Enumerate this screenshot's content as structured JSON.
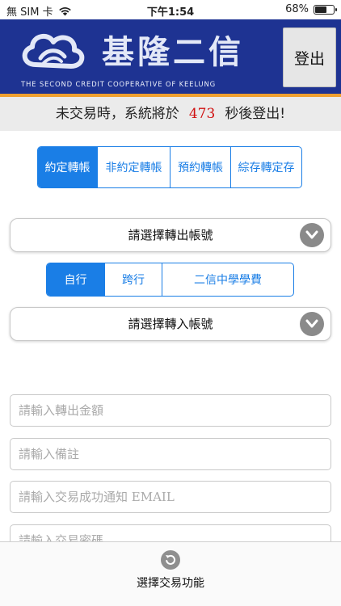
{
  "status_bar": {
    "carrier": "無 SIM 卡",
    "time": "下午1:54",
    "battery": "68%",
    "battery_level": 0.68
  },
  "header": {
    "bank_name": "基隆二信",
    "bank_subtitle": "THE SECOND CREDIT COOPERATIVE OF KEELUNG",
    "logout_label": "登出"
  },
  "timer": {
    "prefix": "未交易時，系統將於",
    "seconds": "473",
    "suffix": "秒後登出!"
  },
  "transfer_tabs": [
    "約定轉帳",
    "非約定轉帳",
    "預約轉帳",
    "綜存轉定存"
  ],
  "from_account": {
    "placeholder": "請選擇轉出帳號"
  },
  "bank_tabs": [
    "自行",
    "跨行",
    "二信中學學費"
  ],
  "to_account": {
    "placeholder": "請選擇轉入帳號"
  },
  "form": {
    "amount_placeholder": "請輸入轉出金額",
    "memo_placeholder": "請輸入備註",
    "email_placeholder": "請輸入交易成功通知 EMAIL",
    "password_placeholder": "請輸入交易密碼"
  },
  "bottom": {
    "label": "選擇交易功能"
  },
  "colors": {
    "brand_blue": "#1e3392",
    "accent_blue": "#1a7ee6",
    "stripe_orange": "#f0a030",
    "timer_red": "#d01010"
  }
}
